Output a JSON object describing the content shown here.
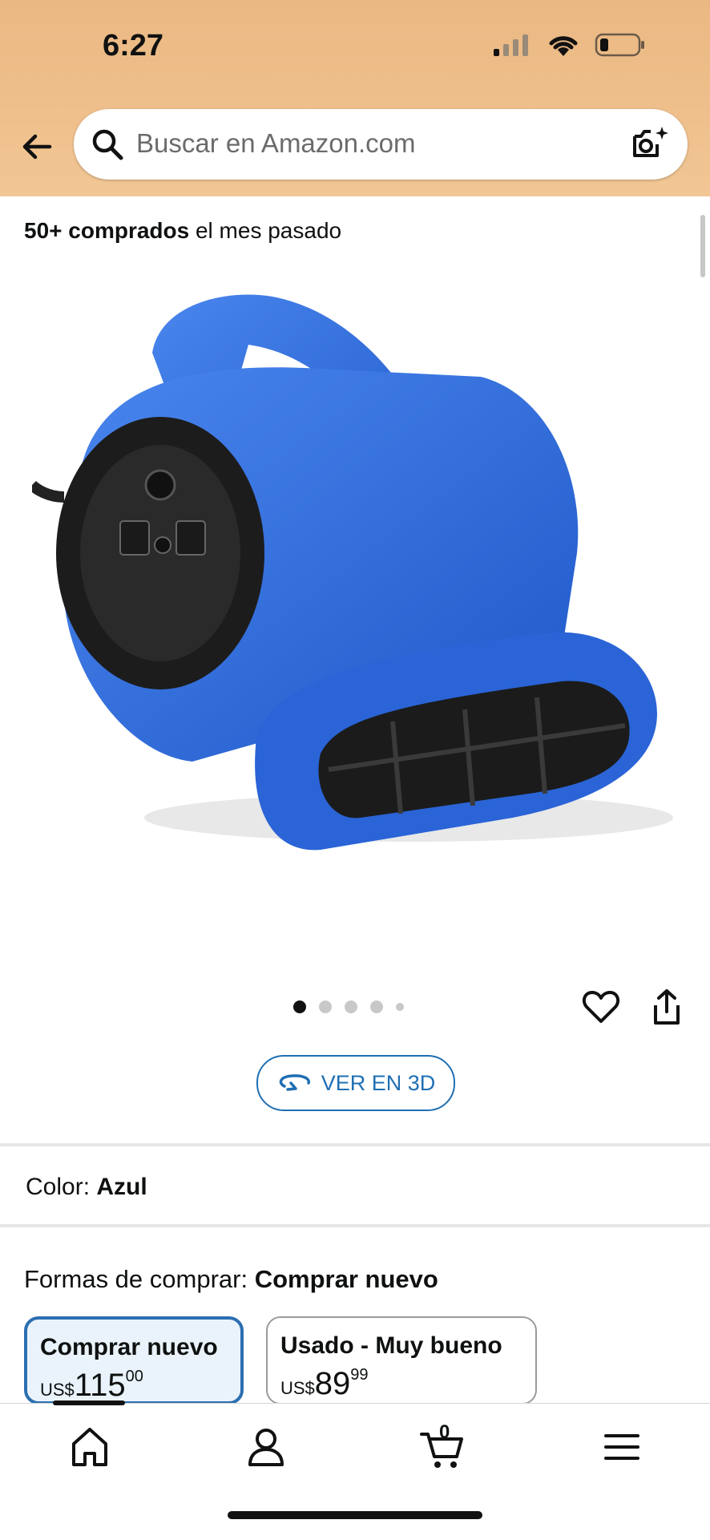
{
  "status": {
    "time": "6:27"
  },
  "search": {
    "placeholder": "Buscar en Amazon.com"
  },
  "bought": {
    "bold": "50+ comprados",
    "rest": " el mes pasado"
  },
  "view3d": {
    "label": "VER EN 3D"
  },
  "color": {
    "label": "Color:",
    "value": "Azul"
  },
  "ways": {
    "label": "Formas de comprar:",
    "value": "Comprar nuevo"
  },
  "options": [
    {
      "title": "Comprar nuevo",
      "currency": "US$",
      "whole": "115",
      "fraction": "00"
    },
    {
      "title": "Usado - Muy bueno",
      "currency": "US$",
      "whole": "89",
      "fraction": "99"
    }
  ],
  "cart": {
    "count": "0"
  },
  "colors": {
    "accent": "#1f6fb3",
    "header": "#efc08c",
    "product": "#2f6fd8"
  }
}
